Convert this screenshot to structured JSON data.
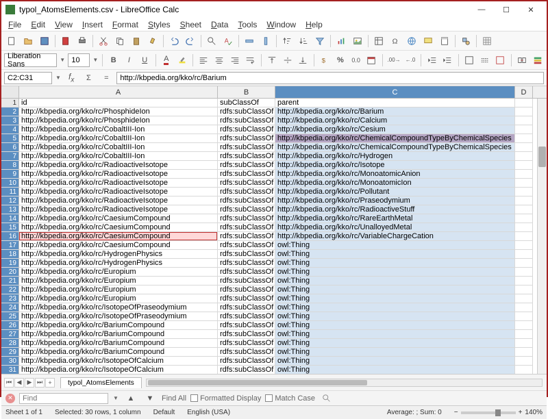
{
  "window": {
    "title": "typol_AtomsElements.csv - LibreOffice Calc"
  },
  "menu": [
    "File",
    "Edit",
    "View",
    "Insert",
    "Format",
    "Styles",
    "Sheet",
    "Data",
    "Tools",
    "Window",
    "Help"
  ],
  "font": {
    "name": "Liberation Sans",
    "size": "10"
  },
  "namebox": {
    "ref": "C2:C31",
    "formula": "http://kbpedia.org/kko/rc/Barium"
  },
  "columns": [
    "A",
    "B",
    "C",
    "D"
  ],
  "header_row": {
    "A": "id",
    "B": "subClassOf",
    "C": "parent"
  },
  "rows": [
    {
      "n": 2,
      "A": "http://kbpedia.org/kko/rc/PhosphideIon",
      "B": "rdfs:subClassOf",
      "C": "http://kbpedia.org/kko/rc/Barium"
    },
    {
      "n": 3,
      "A": "http://kbpedia.org/kko/rc/PhosphideIon",
      "B": "rdfs:subClassOf",
      "C": "http://kbpedia.org/kko/rc/Calcium"
    },
    {
      "n": 4,
      "A": "http://kbpedia.org/kko/rc/CobaltIII-Ion",
      "B": "rdfs:subClassOf",
      "C": "http://kbpedia.org/kko/rc/Cesium"
    },
    {
      "n": 5,
      "A": "http://kbpedia.org/kko/rc/CobaltIII-Ion",
      "B": "rdfs:subClassOf",
      "C": "http://kbpedia.org/kko/rc/ChemicalCompoundTypeByChemicalSpecies"
    },
    {
      "n": 6,
      "A": "http://kbpedia.org/kko/rc/CobaltIII-Ion",
      "B": "rdfs:subClassOf",
      "C": "http://kbpedia.org/kko/rc/ChemicalCompoundTypeByChemicalSpecies"
    },
    {
      "n": 7,
      "A": "http://kbpedia.org/kko/rc/CobaltIII-Ion",
      "B": "rdfs:subClassOf",
      "C": "http://kbpedia.org/kko/rc/Hydrogen"
    },
    {
      "n": 8,
      "A": "http://kbpedia.org/kko/rc/RadioactiveIsotope",
      "B": "rdfs:subClassOf",
      "C": "http://kbpedia.org/kko/rc/Isotope"
    },
    {
      "n": 9,
      "A": "http://kbpedia.org/kko/rc/RadioactiveIsotope",
      "B": "rdfs:subClassOf",
      "C": "http://kbpedia.org/kko/rc/MonoatomicAnion"
    },
    {
      "n": 10,
      "A": "http://kbpedia.org/kko/rc/RadioactiveIsotope",
      "B": "rdfs:subClassOf",
      "C": "http://kbpedia.org/kko/rc/MonoatomicIon"
    },
    {
      "n": 11,
      "A": "http://kbpedia.org/kko/rc/RadioactiveIsotope",
      "B": "rdfs:subClassOf",
      "C": "http://kbpedia.org/kko/rc/Pollutant"
    },
    {
      "n": 12,
      "A": "http://kbpedia.org/kko/rc/RadioactiveIsotope",
      "B": "rdfs:subClassOf",
      "C": "http://kbpedia.org/kko/rc/Praseodymium"
    },
    {
      "n": 13,
      "A": "http://kbpedia.org/kko/rc/RadioactiveIsotope",
      "B": "rdfs:subClassOf",
      "C": "http://kbpedia.org/kko/rc/RadioactiveStuff"
    },
    {
      "n": 14,
      "A": "http://kbpedia.org/kko/rc/CaesiumCompound",
      "B": "rdfs:subClassOf",
      "C": "http://kbpedia.org/kko/rc/RareEarthMetal"
    },
    {
      "n": 15,
      "A": "http://kbpedia.org/kko/rc/CaesiumCompound",
      "B": "rdfs:subClassOf",
      "C": "http://kbpedia.org/kko/rc/UnalloyedMetal"
    },
    {
      "n": 16,
      "A": "http://kbpedia.org/kko/rc/CaesiumCompound",
      "B": "rdfs:subClassOf",
      "C": "http://kbpedia.org/kko/rc/VariableChargeCation",
      "hl": true
    },
    {
      "n": 17,
      "A": "http://kbpedia.org/kko/rc/CaesiumCompound",
      "B": "rdfs:subClassOf",
      "C": "owl:Thing"
    },
    {
      "n": 18,
      "A": "http://kbpedia.org/kko/rc/HydrogenPhysics",
      "B": "rdfs:subClassOf",
      "C": "owl:Thing"
    },
    {
      "n": 19,
      "A": "http://kbpedia.org/kko/rc/HydrogenPhysics",
      "B": "rdfs:subClassOf",
      "C": "owl:Thing"
    },
    {
      "n": 20,
      "A": "http://kbpedia.org/kko/rc/Europium",
      "B": "rdfs:subClassOf",
      "C": "owl:Thing"
    },
    {
      "n": 21,
      "A": "http://kbpedia.org/kko/rc/Europium",
      "B": "rdfs:subClassOf",
      "C": "owl:Thing"
    },
    {
      "n": 22,
      "A": "http://kbpedia.org/kko/rc/Europium",
      "B": "rdfs:subClassOf",
      "C": "owl:Thing"
    },
    {
      "n": 23,
      "A": "http://kbpedia.org/kko/rc/Europium",
      "B": "rdfs:subClassOf",
      "C": "owl:Thing"
    },
    {
      "n": 24,
      "A": "http://kbpedia.org/kko/rc/IsotopeOfPraseodymium",
      "B": "rdfs:subClassOf",
      "C": "owl:Thing"
    },
    {
      "n": 25,
      "A": "http://kbpedia.org/kko/rc/IsotopeOfPraseodymium",
      "B": "rdfs:subClassOf",
      "C": "owl:Thing"
    },
    {
      "n": 26,
      "A": "http://kbpedia.org/kko/rc/BariumCompound",
      "B": "rdfs:subClassOf",
      "C": "owl:Thing"
    },
    {
      "n": 27,
      "A": "http://kbpedia.org/kko/rc/BariumCompound",
      "B": "rdfs:subClassOf",
      "C": "owl:Thing"
    },
    {
      "n": 28,
      "A": "http://kbpedia.org/kko/rc/BariumCompound",
      "B": "rdfs:subClassOf",
      "C": "owl:Thing"
    },
    {
      "n": 29,
      "A": "http://kbpedia.org/kko/rc/BariumCompound",
      "B": "rdfs:subClassOf",
      "C": "owl:Thing"
    },
    {
      "n": 30,
      "A": "http://kbpedia.org/kko/rc/IsotopeOfCalcium",
      "B": "rdfs:subClassOf",
      "C": "owl:Thing"
    },
    {
      "n": 31,
      "A": "http://kbpedia.org/kko/rc/IsotopeOfCalcium",
      "B": "rdfs:subClassOf",
      "C": "owl:Thing"
    }
  ],
  "sheet_tab": "typol_AtomsElements",
  "findbar": {
    "placeholder": "Find",
    "findall": "Find All",
    "formatted": "Formatted Display",
    "matchcase": "Match Case"
  },
  "status": {
    "sheet": "Sheet 1 of 1",
    "selection": "Selected: 30 rows, 1 column",
    "style": "Default",
    "lang": "English (USA)",
    "calc": "Average: ; Sum: 0",
    "zoom": "140%"
  }
}
